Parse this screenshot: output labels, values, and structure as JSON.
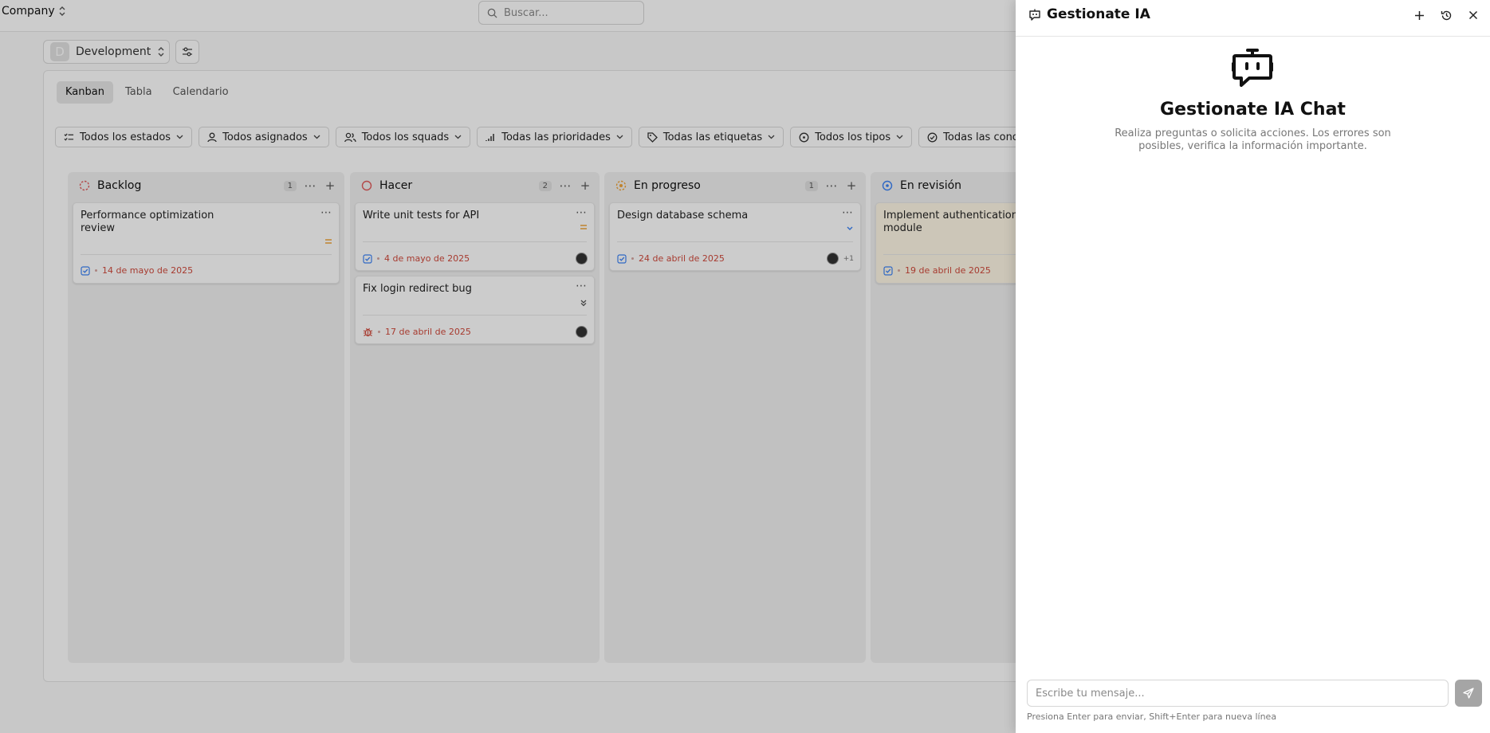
{
  "topbar": {
    "company": "Company",
    "search_placeholder": "Buscar..."
  },
  "project": {
    "avatar_letter": "D",
    "name": "Development"
  },
  "view_tabs": [
    "Kanban",
    "Tabla",
    "Calendario"
  ],
  "filters": [
    "Todos los estados",
    "Todos asignados",
    "Todos los squads",
    "Todas las prioridades",
    "Todas las etiquetas",
    "Todos los tipos",
    "Todas las conclusiones"
  ],
  "columns": [
    {
      "title": "Backlog",
      "count": "1",
      "status_color": "#e05b5b",
      "tasks": [
        {
          "title": "Performance optimization review",
          "date": "14 de mayo de 2025",
          "type_icon": "checkbox-icon",
          "priority_icon": "equals-icon"
        }
      ]
    },
    {
      "title": "Hacer",
      "count": "2",
      "status_color": "#e05b5b",
      "tasks": [
        {
          "title": "Write unit tests for API",
          "date": "4 de mayo de 2025",
          "type_icon": "checkbox-icon",
          "priority_icon": "equals-icon"
        },
        {
          "title": "Fix login redirect bug",
          "date": "17 de abril de 2025",
          "type_icon": "bug-icon",
          "priority_icon": "double-chevron-down-icon"
        }
      ]
    },
    {
      "title": "En progreso",
      "count": "1",
      "status_color": "#f0a43a",
      "tasks": [
        {
          "title": "Design database schema",
          "date": "24 de abril de 2025",
          "type_icon": "checkbox-icon",
          "priority_icon": "chevron-down-icon",
          "extra_assignees": "+1"
        }
      ]
    },
    {
      "title": "En revisión",
      "count": "",
      "status_color": "#3b82f6",
      "tasks": [
        {
          "title": "Implement authentication module",
          "date": "19 de abril de 2025",
          "type_icon": "checkbox-icon"
        }
      ]
    }
  ],
  "chat": {
    "header_title": "Gestionate IA",
    "title": "Gestionate IA Chat",
    "description": "Realiza preguntas o solicita acciones. Los errores son posibles, verifica la información importante.",
    "input_placeholder": "Escribe tu mensaje...",
    "hint": "Presiona Enter para enviar, Shift+Enter para nueva línea"
  }
}
